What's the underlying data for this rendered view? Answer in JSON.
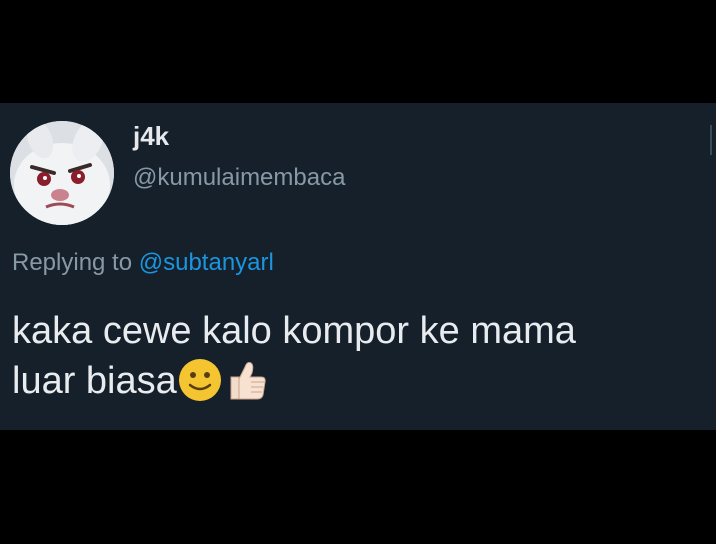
{
  "tweet": {
    "display_name": "j4k",
    "handle": "@kumulaimembaca",
    "reply_prefix": "Replying to",
    "reply_handle": "@subtanyarl",
    "body_line1": "kaka cewe kalo kompor ke mama",
    "body_line2": "luar biasa",
    "emojis": [
      "slightly-smiling-face-icon",
      "thumbs-up-light-skin-icon"
    ]
  },
  "colors": {
    "background": "#000000",
    "tweet_background": "#15202b",
    "primary_text": "#e9ecef",
    "secondary_text": "#8899a6",
    "link": "#1b95e0"
  }
}
